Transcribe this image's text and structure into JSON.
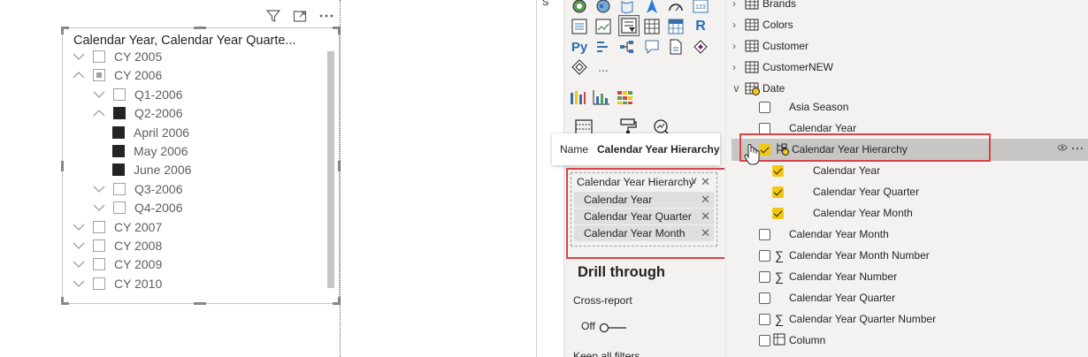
{
  "slicer": {
    "title": "Calendar Year, Calendar Year Quarte...",
    "header_icons": [
      "filter-icon",
      "focus-mode-icon",
      "more-options-icon"
    ],
    "rows": [
      {
        "label": "CY 2005",
        "expanded": false,
        "state": "unchecked",
        "level": 0
      },
      {
        "label": "CY 2006",
        "expanded": true,
        "state": "partial",
        "level": 0
      },
      {
        "label": "Q1-2006",
        "expanded": false,
        "state": "unchecked",
        "level": 1
      },
      {
        "label": "Q2-2006",
        "expanded": true,
        "state": "checked",
        "level": 1
      },
      {
        "label": "April 2006",
        "state": "checked",
        "level": 2
      },
      {
        "label": "May 2006",
        "state": "checked",
        "level": 2
      },
      {
        "label": "June 2006",
        "state": "checked",
        "level": 2
      },
      {
        "label": "Q3-2006",
        "expanded": false,
        "state": "unchecked",
        "level": 1
      },
      {
        "label": "Q4-2006",
        "expanded": false,
        "state": "unchecked",
        "level": 1
      },
      {
        "label": "CY 2007",
        "expanded": false,
        "state": "unchecked",
        "level": 0
      },
      {
        "label": "CY 2008",
        "expanded": false,
        "state": "unchecked",
        "level": 0
      },
      {
        "label": "CY 2009",
        "expanded": false,
        "state": "unchecked",
        "level": 0
      },
      {
        "label": "CY 2010",
        "expanded": false,
        "state": "unchecked",
        "level": 0
      }
    ]
  },
  "visualizations": {
    "side_label": "S",
    "more_visuals": "...",
    "py_label": "Py",
    "r_label": "R",
    "tooltip": {
      "key": "Name",
      "value": "Calendar Year Hierarchy"
    },
    "field_well": {
      "header": "Calendar Year Hierarchy",
      "items": [
        "Calendar Year",
        "Calendar Year Quarter",
        "Calendar Year Month"
      ]
    },
    "drill_through": {
      "heading": "Drill through",
      "cross_report": "Cross-report",
      "toggle_state": "Off",
      "keep_filters": "Keep all filters"
    }
  },
  "fields": {
    "tables": [
      {
        "name": "Brands",
        "expanded": false
      },
      {
        "name": "Colors",
        "expanded": false
      },
      {
        "name": "Customer",
        "expanded": false
      },
      {
        "name": "CustomerNEW",
        "expanded": false
      },
      {
        "name": "Date",
        "expanded": true
      }
    ],
    "date_fields": [
      {
        "name": "Asia Season",
        "checked": false,
        "sigma": false
      },
      {
        "name": "Calendar Year",
        "checked": false,
        "sigma": false
      },
      {
        "name": "Calendar Year Hierarchy",
        "checked": true,
        "sigma": false,
        "hierarchy": true
      },
      {
        "name": "Calendar Year",
        "checked": true,
        "sigma": false,
        "child": true
      },
      {
        "name": "Calendar Year Quarter",
        "checked": true,
        "sigma": false,
        "child": true
      },
      {
        "name": "Calendar Year Month",
        "checked": true,
        "sigma": false,
        "child": true
      },
      {
        "name": "Calendar Year Month",
        "checked": false,
        "sigma": false
      },
      {
        "name": "Calendar Year Month Number",
        "checked": false,
        "sigma": true
      },
      {
        "name": "Calendar Year Number",
        "checked": false,
        "sigma": true
      },
      {
        "name": "Calendar Year Quarter",
        "checked": false,
        "sigma": false
      },
      {
        "name": "Calendar Year Quarter Number",
        "checked": false,
        "sigma": true
      },
      {
        "name": "Column",
        "checked": false,
        "sigma": false,
        "calc": true
      }
    ],
    "row_actions": [
      "eye-icon",
      "more-options-icon"
    ]
  },
  "colors": {
    "accent_yellow": "#f2c811",
    "highlight_red": "#d64545",
    "pane_bg": "#f3f2f1",
    "selected_row": "#c8c6c4"
  }
}
